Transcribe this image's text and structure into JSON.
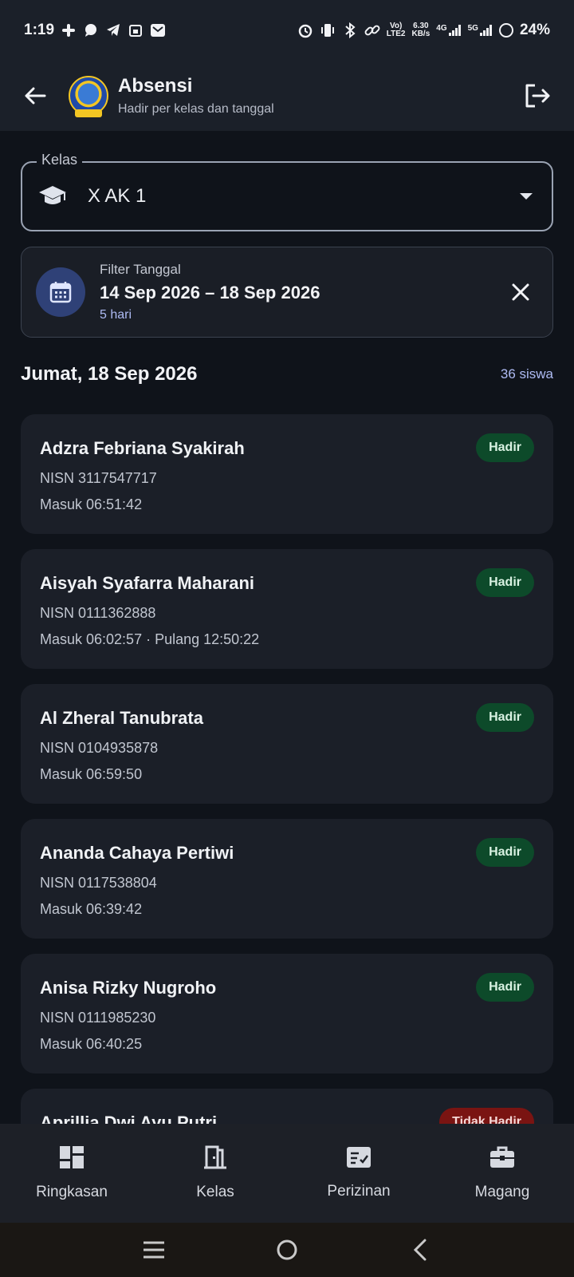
{
  "status_bar": {
    "time": "1:19",
    "network_speed_value": "6.30",
    "network_speed_unit": "KB/s",
    "volte_top": "Vo)",
    "volte_bottom": "LTE2",
    "signal1_label": "4G",
    "signal2_label": "5G",
    "battery": "24%"
  },
  "header": {
    "title": "Absensi",
    "subtitle": "Hadir per kelas dan tanggal"
  },
  "kelas": {
    "label": "Kelas",
    "value": "X AK 1"
  },
  "filter": {
    "label": "Filter Tanggal",
    "range": "14 Sep 2026 – 18 Sep 2026",
    "days": "5 hari"
  },
  "day": {
    "title": "Jumat, 18 Sep 2026",
    "count": "36 siswa"
  },
  "students": [
    {
      "name": "Adzra Febriana Syakirah",
      "nisn": "NISN 3117547717",
      "time": "Masuk 06:51:42",
      "status": "Hadir"
    },
    {
      "name": "Aisyah Syafarra Maharani",
      "nisn": "NISN 0111362888",
      "time": "Masuk 06:02:57 · Pulang 12:50:22",
      "status": "Hadir"
    },
    {
      "name": "Al Zheral Tanubrata",
      "nisn": "NISN 0104935878",
      "time": "Masuk 06:59:50",
      "status": "Hadir"
    },
    {
      "name": "Ananda Cahaya Pertiwi",
      "nisn": "NISN 0117538804",
      "time": "Masuk 06:39:42",
      "status": "Hadir"
    },
    {
      "name": "Anisa Rizky Nugroho",
      "nisn": "NISN 0111985230",
      "time": "Masuk 06:40:25",
      "status": "Hadir"
    },
    {
      "name": "Aprillia Dwi Ayu Putri",
      "nisn": "",
      "time": "",
      "status": "Tidak Hadir"
    }
  ],
  "bottom_nav": [
    {
      "label": "Ringkasan",
      "icon": "dashboard-icon"
    },
    {
      "label": "Kelas",
      "icon": "door-icon"
    },
    {
      "label": "Perizinan",
      "icon": "checklist-icon"
    },
    {
      "label": "Magang",
      "icon": "briefcase-icon"
    }
  ],
  "colors": {
    "background": "#0f131a",
    "header": "#1b2029",
    "card": "#1b1f28",
    "accent": "#aebbf3",
    "present_badge": "#0d4a2a",
    "absent_badge": "#7a1412"
  }
}
